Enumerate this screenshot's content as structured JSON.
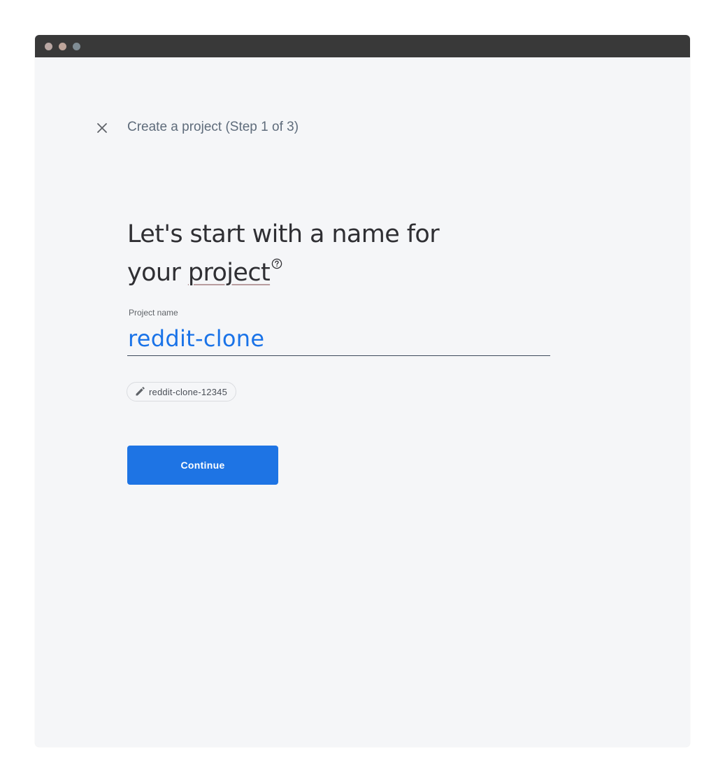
{
  "window": {
    "controls": [
      "close-dot",
      "minimize-dot",
      "zoom-dot"
    ]
  },
  "header": {
    "close_icon": "close-icon",
    "step_title": "Create a project (Step 1 of 3)"
  },
  "main": {
    "heading_line1": "Let's start with a name for",
    "heading_line2_prefix": "your ",
    "heading_keyword": "project",
    "help_icon": "help-circle-icon",
    "project_name_label": "Project name",
    "project_name_value": "reddit-clone",
    "project_id_icon": "pencil-icon",
    "project_id": "reddit-clone-12345",
    "continue_label": "Continue"
  },
  "colors": {
    "accent": "#1a73e8",
    "button": "#1e74e4",
    "background": "#f5f6f8",
    "titlebar": "#393939"
  }
}
